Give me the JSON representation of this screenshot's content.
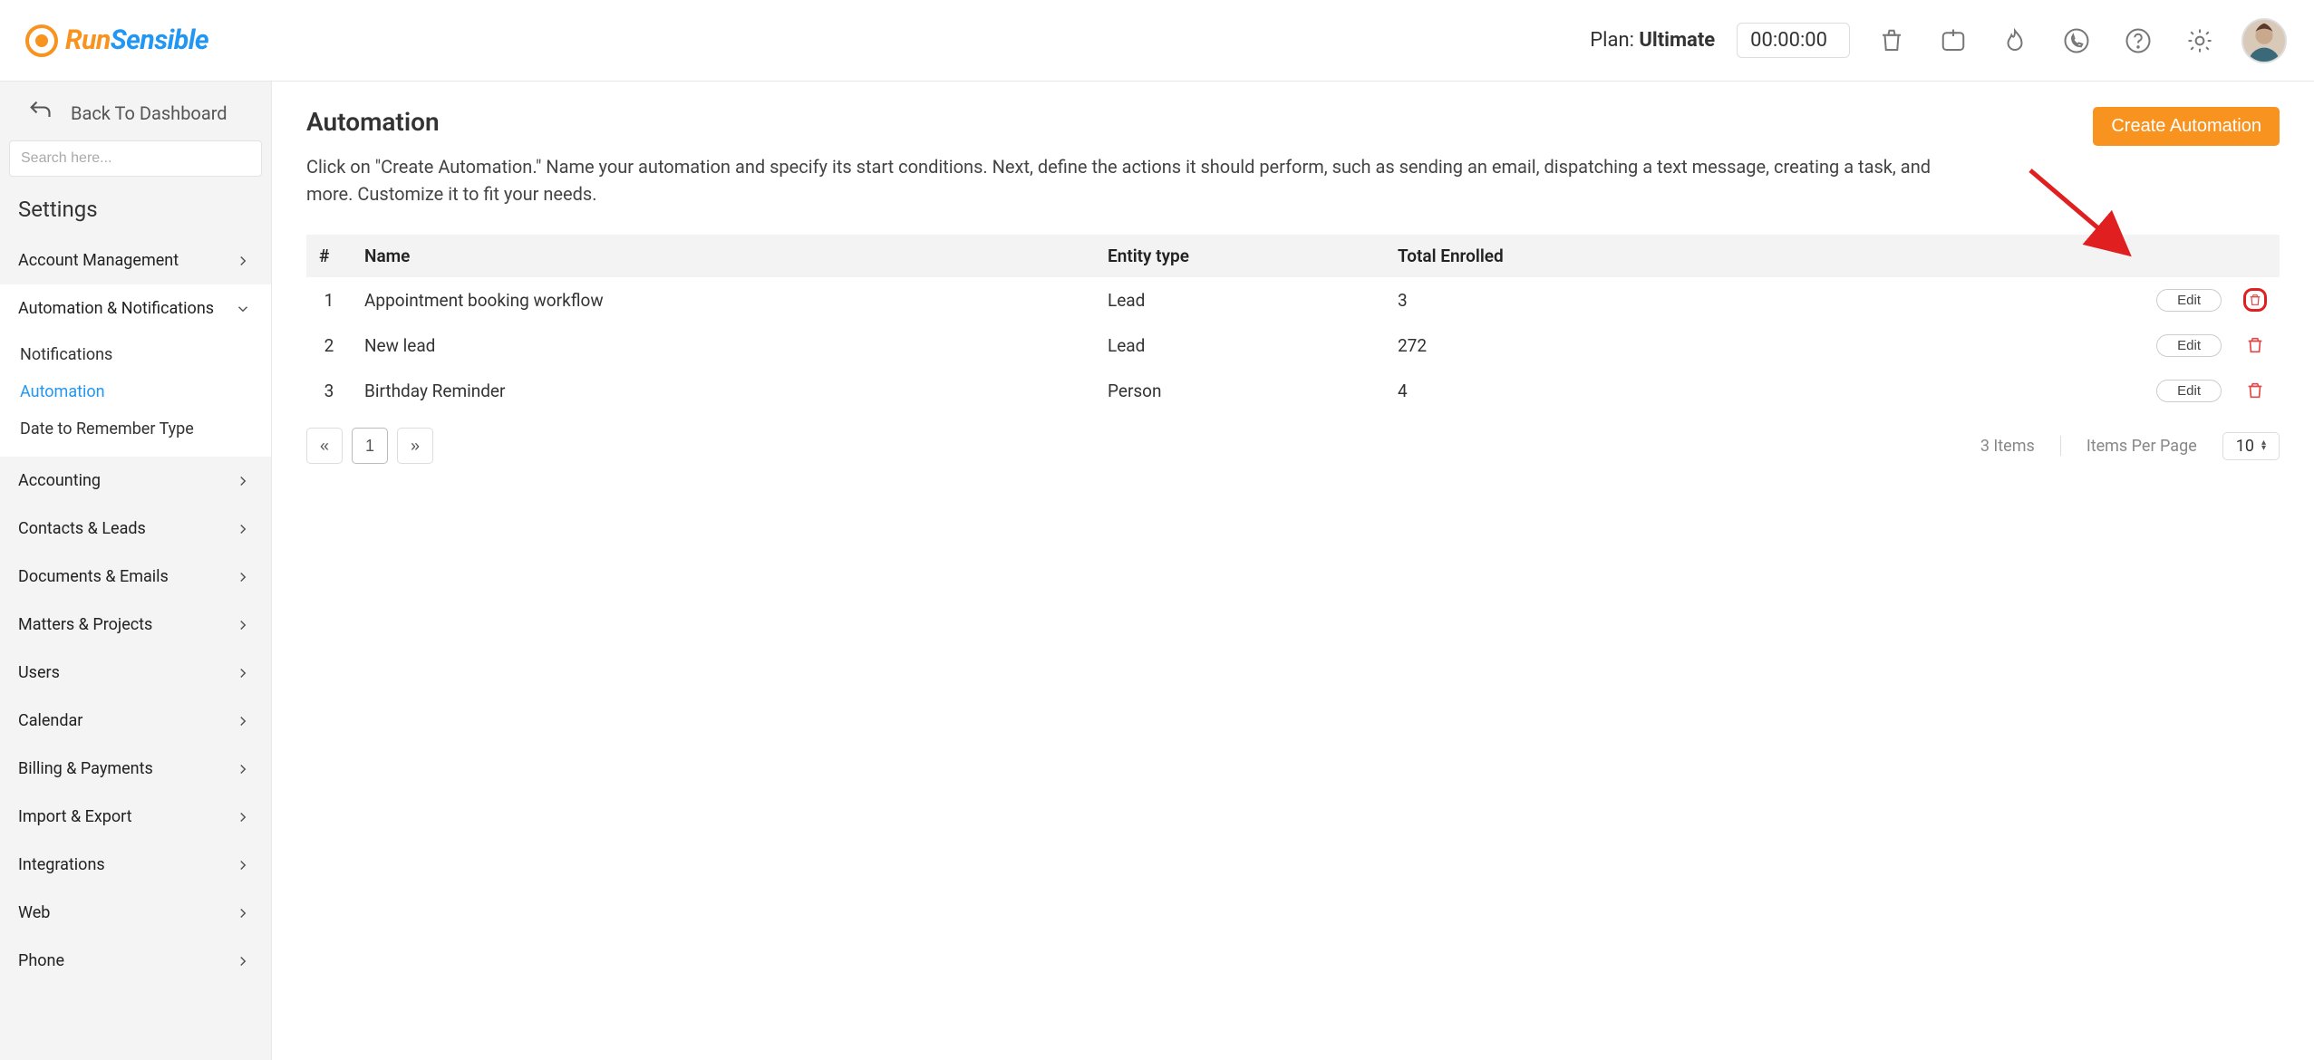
{
  "header": {
    "plan_prefix": "Plan: ",
    "plan_name": "Ultimate",
    "timer": "00:00:00"
  },
  "sidebar": {
    "back_label": "Back To Dashboard",
    "search_placeholder": "Search here...",
    "settings_title": "Settings",
    "items": [
      {
        "label": "Account Management",
        "expanded": false
      },
      {
        "label": "Automation & Notifications",
        "expanded": true,
        "sub": [
          {
            "label": "Notifications",
            "active": false
          },
          {
            "label": "Automation",
            "active": true
          },
          {
            "label": "Date to Remember Type",
            "active": false
          }
        ]
      },
      {
        "label": "Accounting",
        "expanded": false
      },
      {
        "label": "Contacts & Leads",
        "expanded": false
      },
      {
        "label": "Documents & Emails",
        "expanded": false
      },
      {
        "label": "Matters & Projects",
        "expanded": false
      },
      {
        "label": "Users",
        "expanded": false
      },
      {
        "label": "Calendar",
        "expanded": false
      },
      {
        "label": "Billing & Payments",
        "expanded": false
      },
      {
        "label": "Import & Export",
        "expanded": false
      },
      {
        "label": "Integrations",
        "expanded": false
      },
      {
        "label": "Web",
        "expanded": false
      },
      {
        "label": "Phone",
        "expanded": false
      }
    ]
  },
  "main": {
    "title": "Automation",
    "create_label": "Create Automation",
    "description": "Click on \"Create Automation.\" Name your automation and specify its start conditions. Next, define the actions it should perform, such as sending an email, dispatching a text message, creating a task, and more. Customize it to fit your needs.",
    "columns": {
      "num": "#",
      "name": "Name",
      "entity": "Entity type",
      "enrolled": "Total Enrolled"
    },
    "rows": [
      {
        "num": "1",
        "name": "Appointment booking workflow",
        "entity": "Lead",
        "enrolled": "3",
        "edit": "Edit"
      },
      {
        "num": "2",
        "name": "New lead",
        "entity": "Lead",
        "enrolled": "272",
        "edit": "Edit"
      },
      {
        "num": "3",
        "name": "Birthday Reminder",
        "entity": "Person",
        "enrolled": "4",
        "edit": "Edit"
      }
    ],
    "pager": {
      "prev": "«",
      "page": "1",
      "next": "»"
    },
    "footer": {
      "items_label": "3 Items",
      "per_page_label": "Items Per Page",
      "per_page_value": "10"
    }
  }
}
